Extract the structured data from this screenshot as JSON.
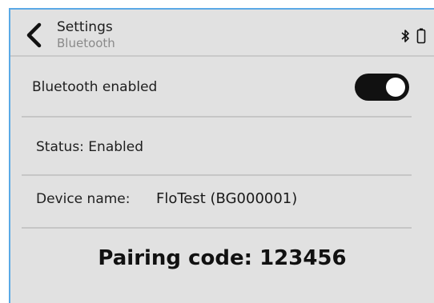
{
  "header": {
    "title": "Settings",
    "subtitle": "Bluetooth",
    "back_icon": "chevron-left-icon",
    "status_icons": [
      "bluetooth-icon",
      "battery-icon"
    ]
  },
  "settings": {
    "bluetooth_label": "Bluetooth enabled",
    "bluetooth_enabled": true,
    "status_text": "Status: Enabled",
    "device_name_label": "Device name:",
    "device_name_value": "FloTest (BG000001)",
    "pairing_text": "Pairing code: 123456"
  },
  "colors": {
    "background": "#e1e1e1",
    "divider": "#c6c6c6",
    "toggle_on": "#111111",
    "frame_border": "#5aa9e6",
    "subtitle": "#8a8a8a"
  }
}
